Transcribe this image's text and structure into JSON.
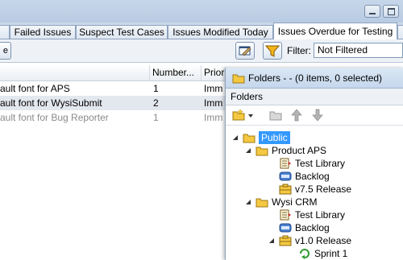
{
  "tabs": [
    {
      "label": "Failed Issues"
    },
    {
      "label": "Suspect Test Cases"
    },
    {
      "label": "Issues Modified Today"
    },
    {
      "label": "Issues Overdue for Testing"
    },
    {
      "label": ""
    }
  ],
  "toolbar": {
    "partial_button_label": "e",
    "filter_label": "Filter:",
    "filter_value": "Not Filtered"
  },
  "grid": {
    "columns": [
      {
        "label": ""
      },
      {
        "label": "Number..."
      },
      {
        "label": "Prior"
      }
    ],
    "rows": [
      {
        "summary": "ault font for APS",
        "number": "1",
        "priority": "Imm"
      },
      {
        "summary": "ault font for WysiSubmit",
        "number": "2",
        "priority": "Imm"
      },
      {
        "summary": "ault font for Bug Reporter",
        "number": "1",
        "priority": "Imm"
      }
    ]
  },
  "folders_panel": {
    "title": "Folders -  - (0 items, 0 selected)",
    "section_label": "Folders",
    "tree": [
      {
        "label": "Public",
        "icon": "folder-icon"
      },
      {
        "label": "Product APS",
        "icon": "folder-icon"
      },
      {
        "label": "Test Library",
        "icon": "test-library-icon"
      },
      {
        "label": "Backlog",
        "icon": "backlog-icon"
      },
      {
        "label": "v7.5 Release",
        "icon": "release-icon"
      },
      {
        "label": "Wysi CRM",
        "icon": "folder-icon"
      },
      {
        "label": "Test Library",
        "icon": "test-library-icon"
      },
      {
        "label": "Backlog",
        "icon": "backlog-icon"
      },
      {
        "label": "v1.0 Release",
        "icon": "release-icon"
      },
      {
        "label": "Sprint 1",
        "icon": "sprint-icon"
      }
    ]
  },
  "colors": {
    "accent": "#3399ff",
    "tab_strip": "#c9d8ea",
    "filter_icon": "#f2b51c",
    "folder_icon": "#f5c842"
  }
}
